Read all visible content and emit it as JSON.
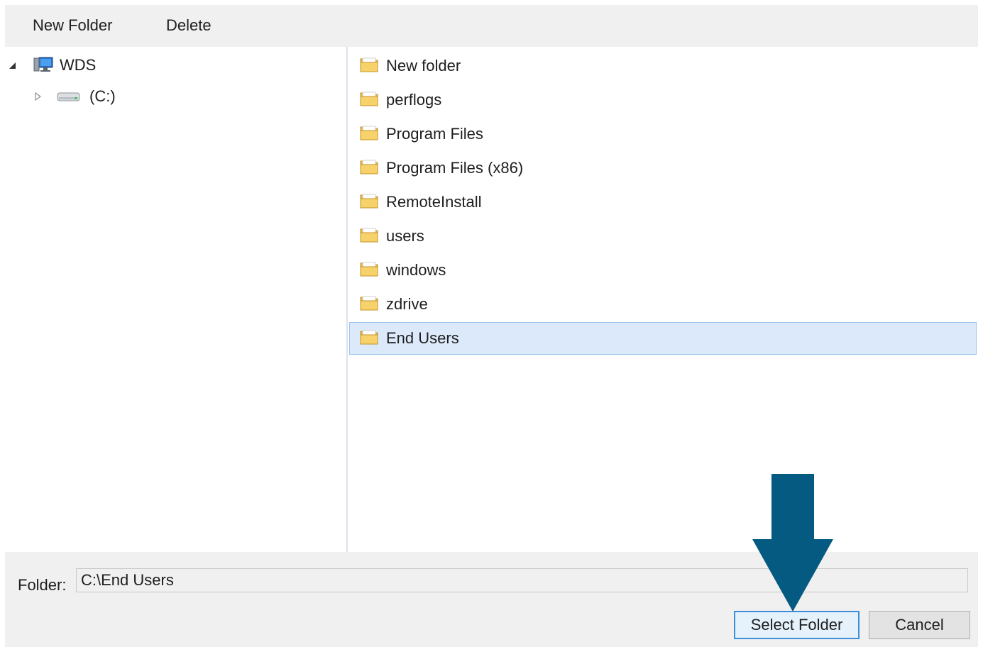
{
  "toolbar": {
    "new_folder_label": "New Folder",
    "delete_label": "Delete"
  },
  "tree": {
    "root_label": "WDS",
    "root_icon": "computer-icon",
    "drive_label": "(C:)",
    "drive_icon": "drive-icon"
  },
  "folders": {
    "items": [
      {
        "label": "New folder"
      },
      {
        "label": "perflogs"
      },
      {
        "label": "Program Files"
      },
      {
        "label": "Program Files (x86)"
      },
      {
        "label": "RemoteInstall"
      },
      {
        "label": "users"
      },
      {
        "label": "windows"
      },
      {
        "label": "zdrive"
      },
      {
        "label": "End Users",
        "selected": true
      }
    ],
    "icon": "folder-icon"
  },
  "bottom": {
    "folder_field_label": "Folder:",
    "folder_path": "C:\\End Users",
    "select_button": "Select Folder",
    "cancel_button": "Cancel"
  },
  "colors": {
    "selection_bg": "#dbe9fa",
    "selection_border": "#99c3ee",
    "arrow": "#045a80",
    "panel_bg": "#f0f0f0"
  }
}
